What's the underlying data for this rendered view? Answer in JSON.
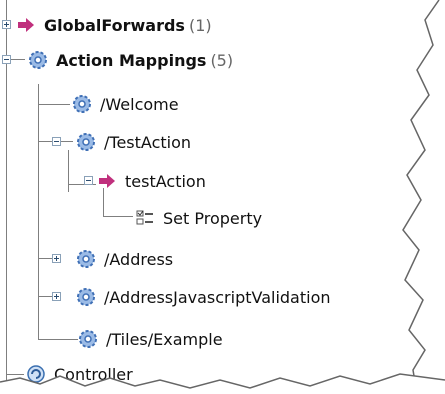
{
  "tree": {
    "global_forwards": {
      "label": "GlobalForwards",
      "count": "(1)"
    },
    "action_mappings": {
      "label": "Action Mappings",
      "count": "(5)"
    },
    "welcome": {
      "label": "/Welcome"
    },
    "test_action": {
      "label": "/TestAction"
    },
    "test_action_forward": {
      "label": "testAction"
    },
    "set_property": {
      "label": "Set Property"
    },
    "address": {
      "label": "/Address"
    },
    "address_js_validation": {
      "label": "/AddressJavascriptValidation"
    },
    "tiles_example": {
      "label": "/Tiles/Example"
    },
    "controller": {
      "label": "Controller"
    }
  },
  "icons": {
    "global_forwards": "arrow-icon",
    "mapping": "gear-icon",
    "forward": "arrow-icon",
    "property": "property-icon",
    "controller": "controller-icon"
  },
  "colors": {
    "arrow": "#c0307d",
    "gear": "#3f6fb5",
    "gear_light": "#9bbbe6",
    "tree_line": "#7f7f7f"
  }
}
